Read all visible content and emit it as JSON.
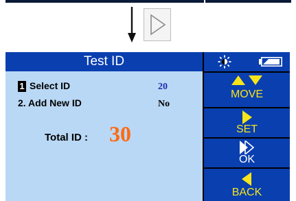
{
  "screen": {
    "title": "Test ID",
    "menu": [
      {
        "number": "1",
        "label": "Select ID",
        "value": "20"
      },
      {
        "label": "2. Add New ID",
        "value": "No"
      }
    ],
    "total_label": "Total ID :",
    "total_value": "30"
  },
  "softkeys": {
    "move": "MOVE",
    "set": "SET",
    "ok": "OK",
    "back": "BACK"
  },
  "status_icons": [
    "brightness-icon",
    "battery-icon"
  ],
  "colors": {
    "title_bar": "#0a3fb0",
    "panel_bg": "#b9d8f5",
    "softkey_text": "#f6e51a",
    "total_value": "#ff6a13",
    "value_blue": "#1a2fb0"
  }
}
